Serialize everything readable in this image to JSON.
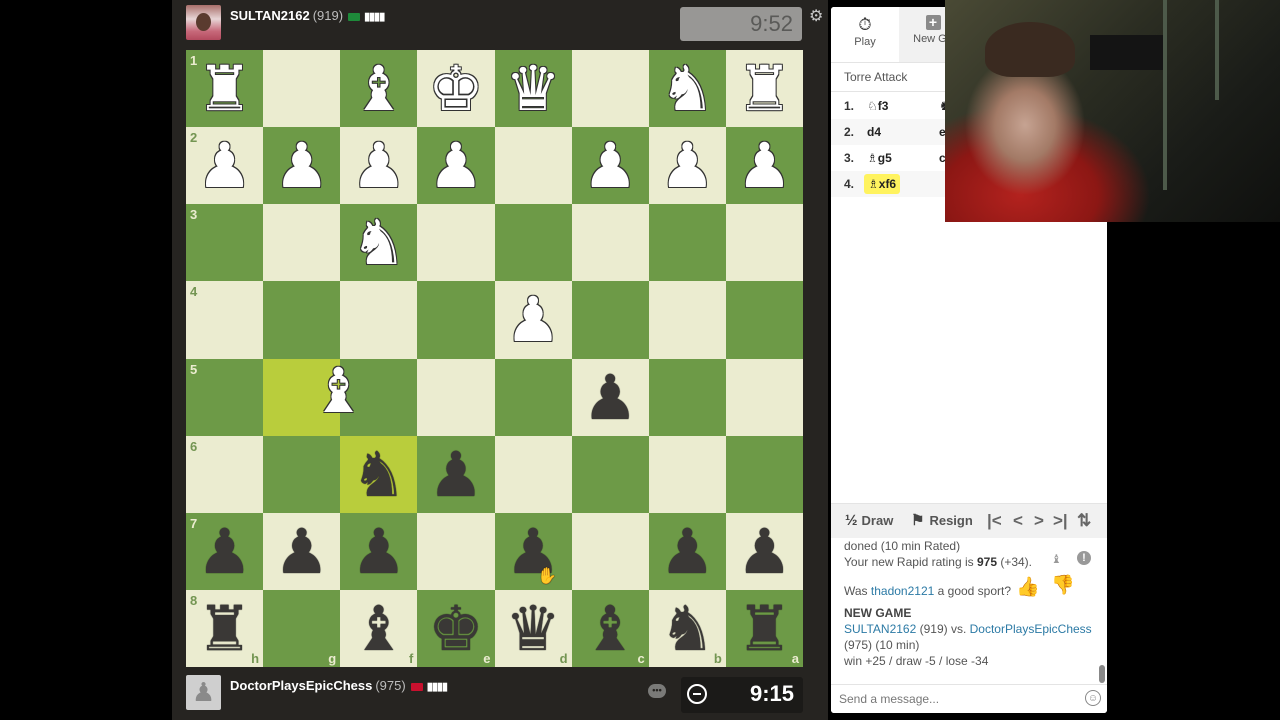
{
  "top_player": {
    "name": "SULTAN2162",
    "rating": "(919)",
    "flag": "saudi-arabia",
    "flag_color": "#1e8a3a",
    "connection": "▮▮▮▮",
    "clock": "9:52",
    "clock_active": false
  },
  "bottom_player": {
    "name": "DoctorPlaysEpicChess",
    "rating": "(975)",
    "flag": "latvia-style",
    "flag_color": "#c8102e",
    "connection": "▮▮▮▮",
    "clock": "9:15",
    "clock_active": true
  },
  "icons": {
    "gear": "⚙",
    "chat": "•••",
    "avatar_placeholder": "♟"
  },
  "board": {
    "orientation": "black",
    "ranks_top_to_bottom": [
      "1",
      "2",
      "3",
      "4",
      "5",
      "6",
      "7",
      "8"
    ],
    "files_left_to_right": [
      "h",
      "g",
      "f",
      "e",
      "d",
      "c",
      "b",
      "a"
    ],
    "highlight_squares": [
      "g5",
      "f6"
    ],
    "light_color": "#ebecd0",
    "dark_color": "#6d9a47",
    "highlight_color": "#b9cd3c",
    "pieces": {
      "a1": "wR",
      "b1": "wN",
      "d1": "wQ",
      "e1": "wK",
      "f1": "wB",
      "h1": "wR",
      "a2": "wP",
      "b2": "wP",
      "c2": "wP",
      "e2": "wP",
      "f2": "wP",
      "g2": "wP",
      "h2": "wP",
      "f3": "wN",
      "d4": "wP",
      "c5": "bP",
      "e6": "bP",
      "f6": "bN",
      "a7": "bP",
      "b7": "bP",
      "d7": "bP",
      "f7": "bP",
      "g7": "bP",
      "h7": "bP",
      "a8": "bR",
      "b8": "bN",
      "c8": "bB",
      "d8": "bQ",
      "e8": "bK",
      "f8": "bB",
      "h8": "bR"
    },
    "dragging_piece": "wB"
  },
  "sidebar": {
    "tabs": [
      {
        "label": "Play",
        "icon": "⏱"
      },
      {
        "label": "New Ga",
        "icon": "+"
      }
    ],
    "opening": "Torre Attack",
    "moves": [
      {
        "no": "1.",
        "white_fig": "♘",
        "white": "f3",
        "black": "♞"
      },
      {
        "no": "2.",
        "white_fig": "",
        "white": "d4",
        "black": "e"
      },
      {
        "no": "3.",
        "white_fig": "♗",
        "white": "g5",
        "black": "c"
      },
      {
        "no": "4.",
        "white_fig": "♗",
        "white": "xf6",
        "black": "",
        "current": true
      }
    ],
    "controls": {
      "draw_symbol": "½",
      "draw": "Draw",
      "resign_icon": "⚑",
      "resign": "Resign",
      "first": "|<",
      "prev": "<",
      "next": ">",
      "last": ">|",
      "flip": "⇅"
    },
    "chat": {
      "line1": "doned (10 min Rated)",
      "line2_pre": "Your new Rapid rating is ",
      "line2_rating": "975",
      "line2_post": " (+34).",
      "sport_pre": "Was ",
      "sport_user": "thadon2121",
      "sport_post": " a good sport?",
      "new_game": "NEW GAME",
      "ng_white": "SULTAN2162",
      "ng_white_rating": " (919) vs. ",
      "ng_black": "DoctorPlaysEpicChess",
      "ng_details": "(975) (10 min)",
      "ng_odds": "win +25 / draw -5 / lose -34"
    },
    "message_placeholder": "Send a message...",
    "smiley": "☺"
  }
}
